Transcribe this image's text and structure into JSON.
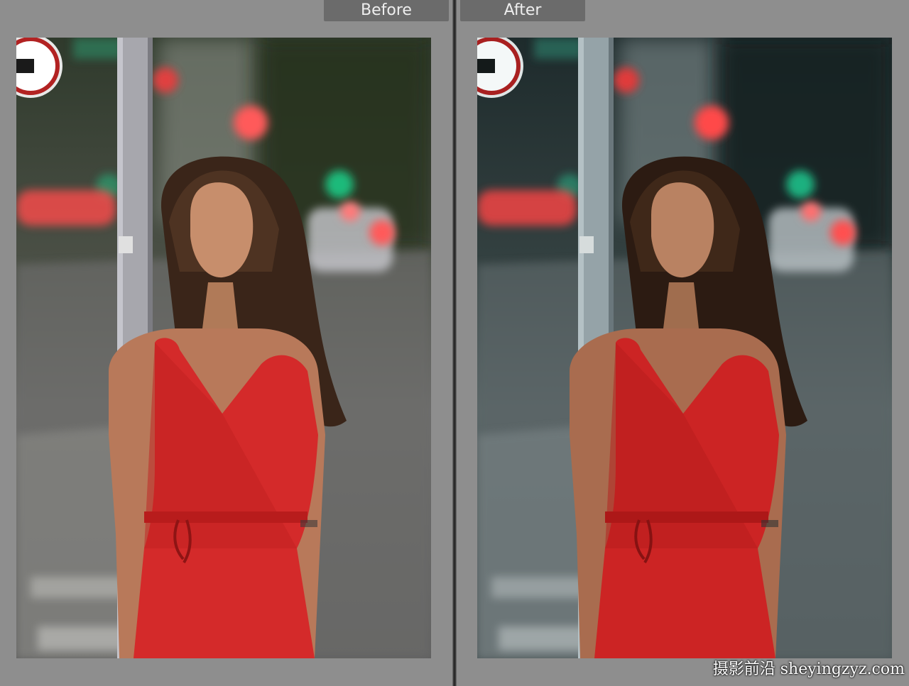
{
  "comparison": {
    "before": {
      "label": "Before"
    },
    "after": {
      "label": "After"
    }
  },
  "watermark": {
    "text": "摄影前沿 sheyingzyz.com"
  },
  "colors": {
    "background": "#8e8e8e",
    "tab": "#6b6b6b",
    "dress_before": "#d42a2a",
    "dress_after": "#cc2424"
  }
}
